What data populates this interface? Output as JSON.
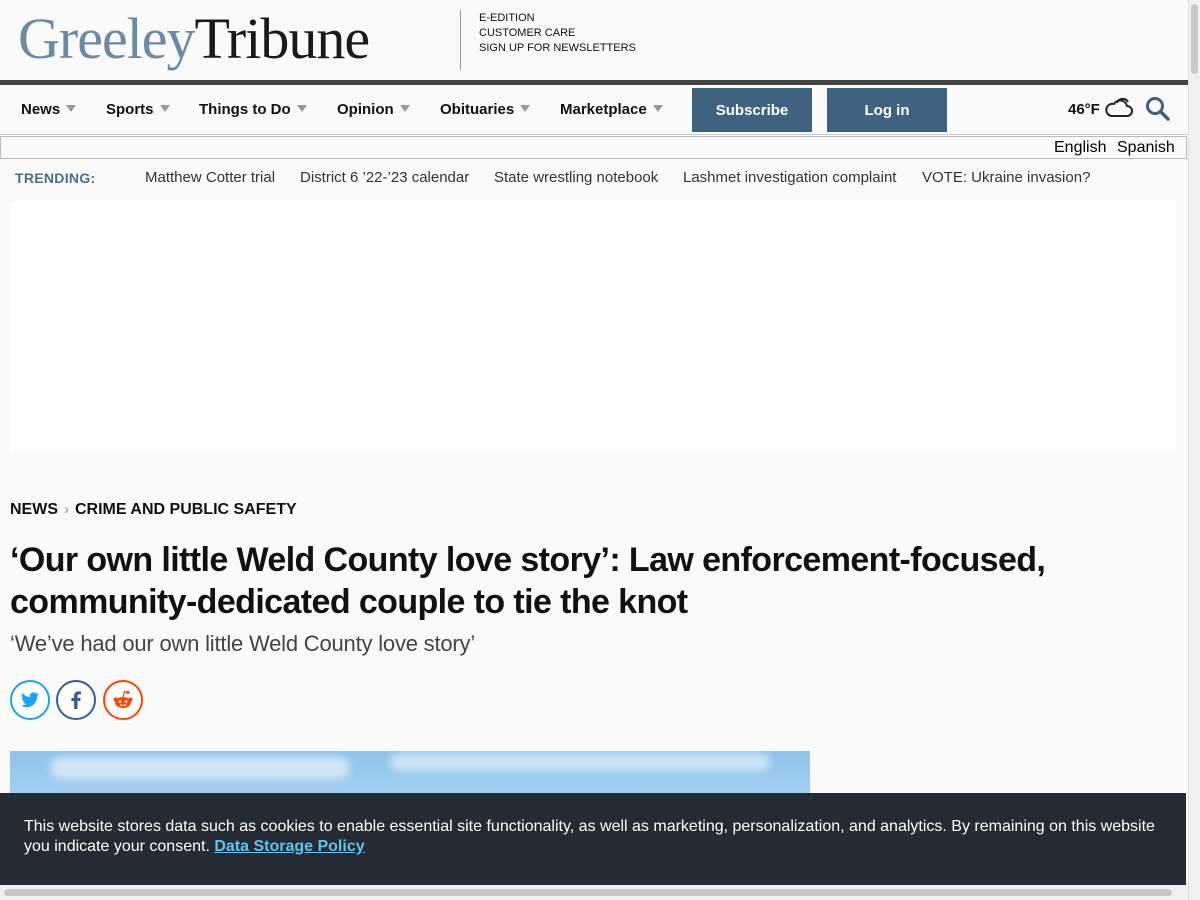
{
  "header": {
    "logo_part1": "Greeley",
    "logo_part2": "Tribune",
    "links": [
      "E-EDITION",
      "CUSTOMER CARE",
      "SIGN UP FOR NEWSLETTERS"
    ]
  },
  "nav": {
    "items": [
      "News",
      "Sports",
      "Things to Do",
      "Opinion",
      "Obituaries",
      "Marketplace"
    ],
    "subscribe_label": "Subscribe",
    "login_label": "Log in",
    "temperature": "46°F",
    "weather_icon": "cloud-icon"
  },
  "language": {
    "options": [
      "English",
      "Spanish"
    ]
  },
  "trending": {
    "label": "TRENDING:",
    "links": [
      "Matthew Cotter trial",
      "District 6 ’22-’23 calendar",
      "State wrestling notebook",
      "Lashmet investigation complaint",
      "VOTE: Ukraine invasion?"
    ]
  },
  "article": {
    "breadcrumb": [
      "NEWS",
      "CRIME AND PUBLIC SAFETY"
    ],
    "headline": "‘Our own little Weld County love story’: Law enforcement-focused, community-dedicated couple to tie the knot",
    "subhead": "‘We’ve had our own little Weld County love story’",
    "share": [
      "twitter-icon",
      "facebook-icon",
      "reddit-icon"
    ]
  },
  "cookie": {
    "text": "This website stores data such as cookies to enable essential site functionality, as well as marketing, personalization, and analytics. By remaining on this website you indicate your consent.",
    "link_label": "Data Storage Policy"
  },
  "colors": {
    "brand_blue": "#3f6281",
    "logo_blue": "#6b8aa3",
    "banner_bg": "#252b34",
    "link_cyan": "#5fc3ef",
    "twitter": "#1da1f2",
    "facebook": "#3b5998",
    "reddit": "#ff4500"
  }
}
